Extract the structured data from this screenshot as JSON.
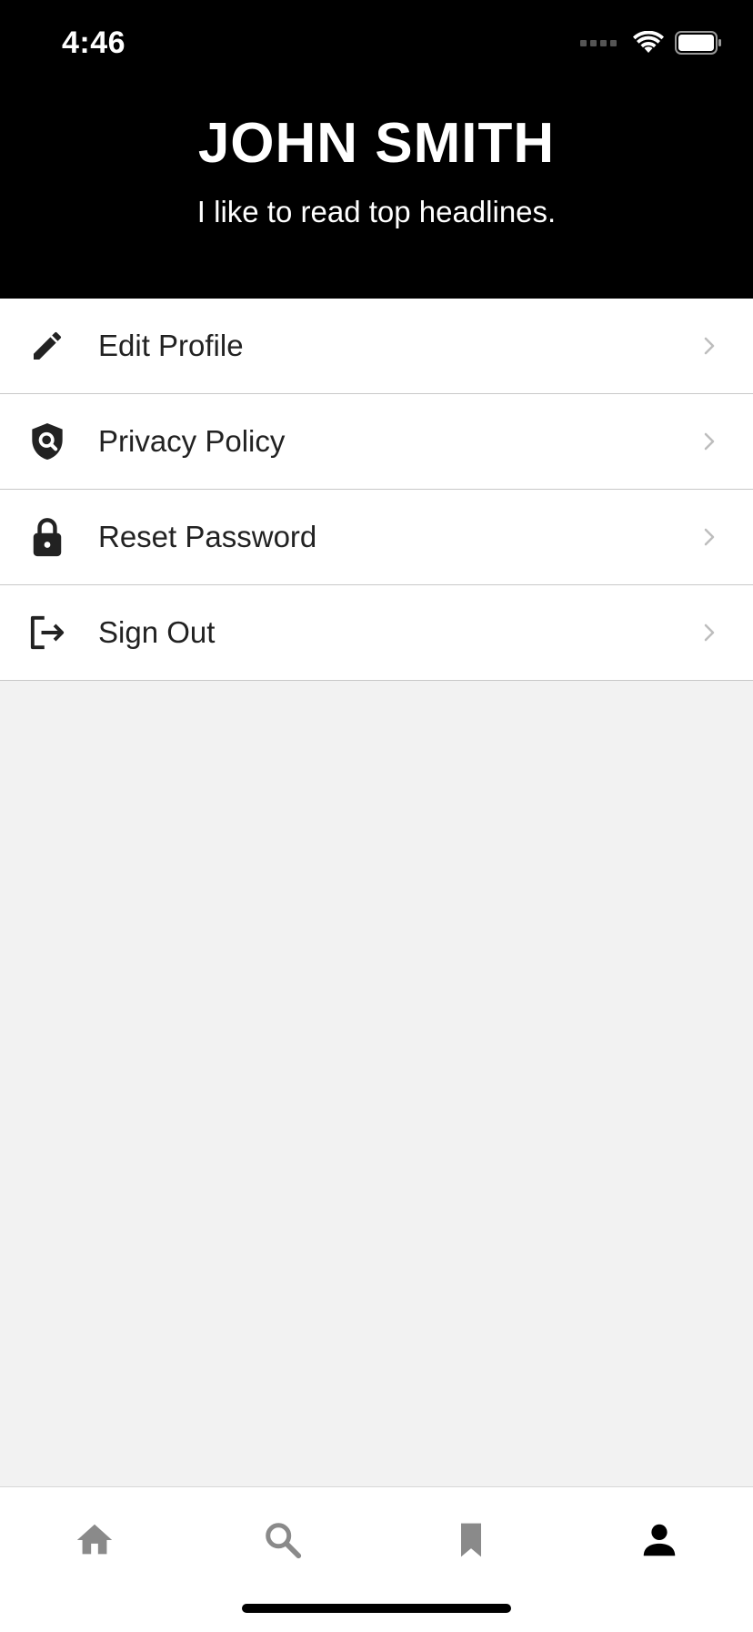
{
  "status_bar": {
    "time": "4:46"
  },
  "profile": {
    "name": "JOHN SMITH",
    "bio": "I like to read top headlines."
  },
  "menu": {
    "items": [
      {
        "label": "Edit Profile",
        "icon": "pencil-icon"
      },
      {
        "label": "Privacy Policy",
        "icon": "shield-search-icon"
      },
      {
        "label": "Reset Password",
        "icon": "lock-icon"
      },
      {
        "label": "Sign Out",
        "icon": "logout-icon"
      }
    ]
  },
  "tab_bar": {
    "tabs": [
      {
        "name": "home",
        "icon": "home-icon",
        "active": false
      },
      {
        "name": "search",
        "icon": "search-icon",
        "active": false
      },
      {
        "name": "bookmarks",
        "icon": "bookmark-icon",
        "active": false
      },
      {
        "name": "profile",
        "icon": "person-icon",
        "active": true
      }
    ],
    "active_color": "#000000",
    "inactive_color": "#8a8a8a"
  },
  "colors": {
    "header_bg": "#000000",
    "page_bg": "#f2f2f2",
    "icon": "#222222"
  }
}
